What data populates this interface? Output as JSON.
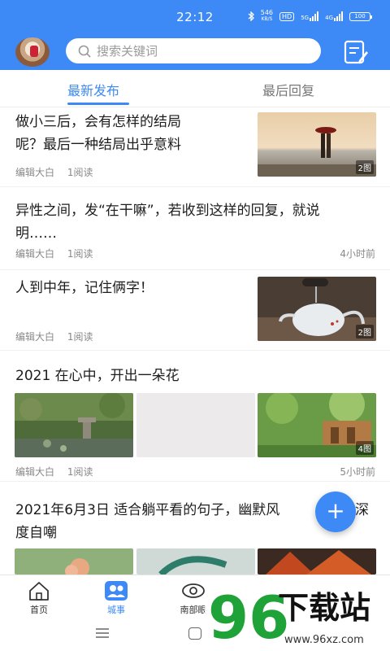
{
  "status_bar": {
    "time": "22:12",
    "net_speed": "546",
    "net_unit": "KB/S",
    "hd": "HD",
    "net1": "5G",
    "net2": "4G",
    "battery": "100"
  },
  "header": {
    "search_placeholder": "搜索关键词"
  },
  "tabs": [
    "最新发布",
    "最后回复"
  ],
  "feed": [
    {
      "title_line1": "做小三后，会有怎样的结局",
      "title_line2": "呢？最后一种结局出乎意料",
      "author": "编辑大白",
      "reads": "1阅读",
      "time": "",
      "badge": "2图"
    },
    {
      "title_line1": "异性之间，发“在干嘛”，若收到这样的回复，就说",
      "title_line2": "明……",
      "author": "编辑大白",
      "reads": "1阅读",
      "time": "4小时前"
    },
    {
      "title_line1": "人到中年，记住俩字！",
      "author": "编辑大白",
      "reads": "1阅读",
      "badge": "2图"
    },
    {
      "title_line1": "2021 在心中，开出一朵花",
      "author": "编辑大白",
      "reads": "1阅读",
      "time": "5小时前",
      "badge": "4图"
    },
    {
      "title_line1": "2021年6月3日 适合躺平看的句子，幽默风",
      "title_line1_tail": "深",
      "title_line2": "度自嘲"
    }
  ],
  "fab_label": "+",
  "bottom_nav": [
    {
      "label": "首页",
      "icon": "home-icon"
    },
    {
      "label": "城事",
      "icon": "city-news-icon"
    },
    {
      "label": "南部眼",
      "icon": "eye-icon"
    }
  ],
  "watermark": {
    "text": "下载站",
    "number": "96",
    "url": "www.96xz.com"
  },
  "colors": {
    "primary": "#3d8af7",
    "text": "#1d1d1d",
    "meta": "#888888"
  }
}
